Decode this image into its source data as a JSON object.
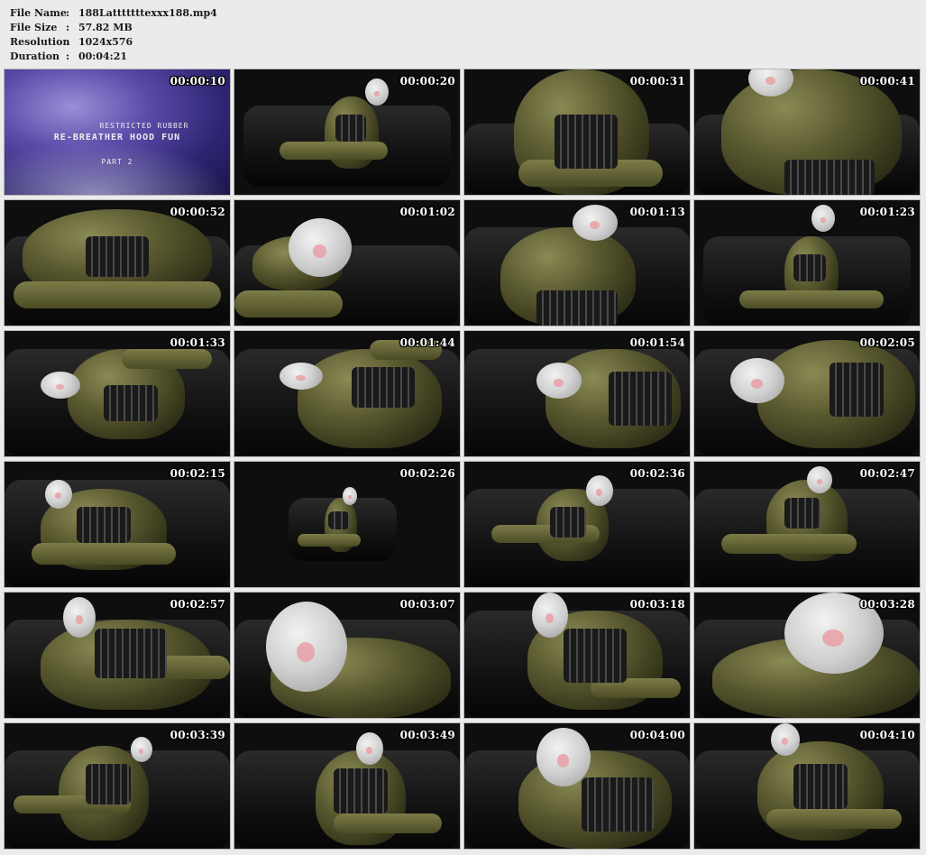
{
  "info": {
    "file_name_label": "File Name",
    "file_name": "188Latttttttexxx188.mp4",
    "file_size_label": "File Size",
    "file_size": "57.82 MB",
    "resolution_label": "Resolution",
    "resolution": "1024x576",
    "duration_label": "Duration",
    "duration": "00:04:21",
    "separator": ":"
  },
  "title_card": {
    "line1": "RESTRICTED RUBBER",
    "line2": "RE-BREATHER HOOD FUN",
    "line3": "PART 2"
  },
  "thumbnails": [
    {
      "time": "00:00:10"
    },
    {
      "time": "00:00:20"
    },
    {
      "time": "00:00:31"
    },
    {
      "time": "00:00:41"
    },
    {
      "time": "00:00:52"
    },
    {
      "time": "00:01:02"
    },
    {
      "time": "00:01:13"
    },
    {
      "time": "00:01:23"
    },
    {
      "time": "00:01:33"
    },
    {
      "time": "00:01:44"
    },
    {
      "time": "00:01:54"
    },
    {
      "time": "00:02:05"
    },
    {
      "time": "00:02:15"
    },
    {
      "time": "00:02:26"
    },
    {
      "time": "00:02:36"
    },
    {
      "time": "00:02:47"
    },
    {
      "time": "00:02:57"
    },
    {
      "time": "00:03:07"
    },
    {
      "time": "00:03:18"
    },
    {
      "time": "00:03:28"
    },
    {
      "time": "00:03:39"
    },
    {
      "time": "00:03:49"
    },
    {
      "time": "00:04:00"
    },
    {
      "time": "00:04:10"
    }
  ]
}
